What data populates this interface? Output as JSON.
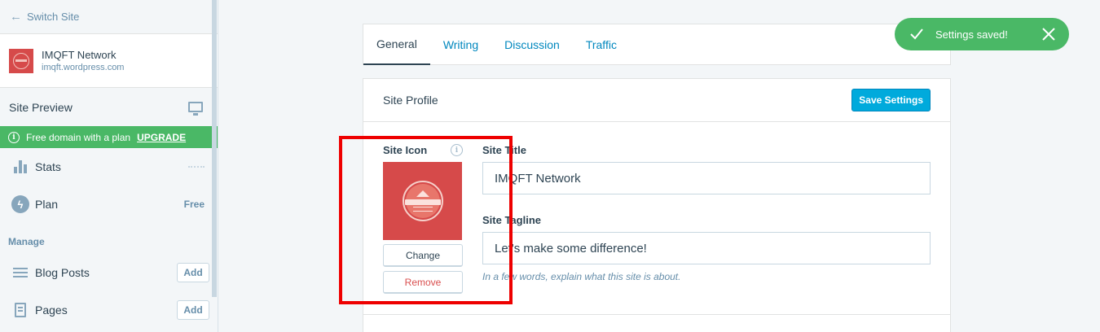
{
  "sidebar": {
    "switch_site": "Switch Site",
    "site": {
      "name": "IMQFT Network",
      "url": "imqft.wordpress.com"
    },
    "site_preview": "Site Preview",
    "promo": {
      "text": "Free domain with a plan",
      "link": "UPGRADE"
    },
    "items": {
      "stats": {
        "label": "Stats",
        "icon": "stats-icon"
      },
      "plan": {
        "label": "Plan",
        "badge": "Free",
        "icon": "plan-icon"
      },
      "blog_posts": {
        "label": "Blog Posts",
        "action": "Add",
        "icon": "posts-icon"
      },
      "pages": {
        "label": "Pages",
        "action": "Add",
        "icon": "pages-icon"
      }
    },
    "manage_heading": "Manage"
  },
  "tabs": [
    {
      "label": "General",
      "active": true
    },
    {
      "label": "Writing",
      "active": false
    },
    {
      "label": "Discussion",
      "active": false
    },
    {
      "label": "Traffic",
      "active": false
    }
  ],
  "profile": {
    "title": "Site Profile",
    "save_label": "Save Settings",
    "site_icon": {
      "label": "Site Icon",
      "change_label": "Change",
      "remove_label": "Remove"
    },
    "site_title": {
      "label": "Site Title",
      "value": "IMQFT Network"
    },
    "site_tagline": {
      "label": "Site Tagline",
      "value": "Let's make some difference!",
      "hint": "In a few words, explain what this site is about."
    }
  },
  "notice": {
    "text": "Settings saved!"
  },
  "colors": {
    "accent": "#00aadc",
    "link": "#0087be",
    "success": "#4ab866",
    "highlight": "#ee0000",
    "icon_bg": "#d64a4a"
  }
}
